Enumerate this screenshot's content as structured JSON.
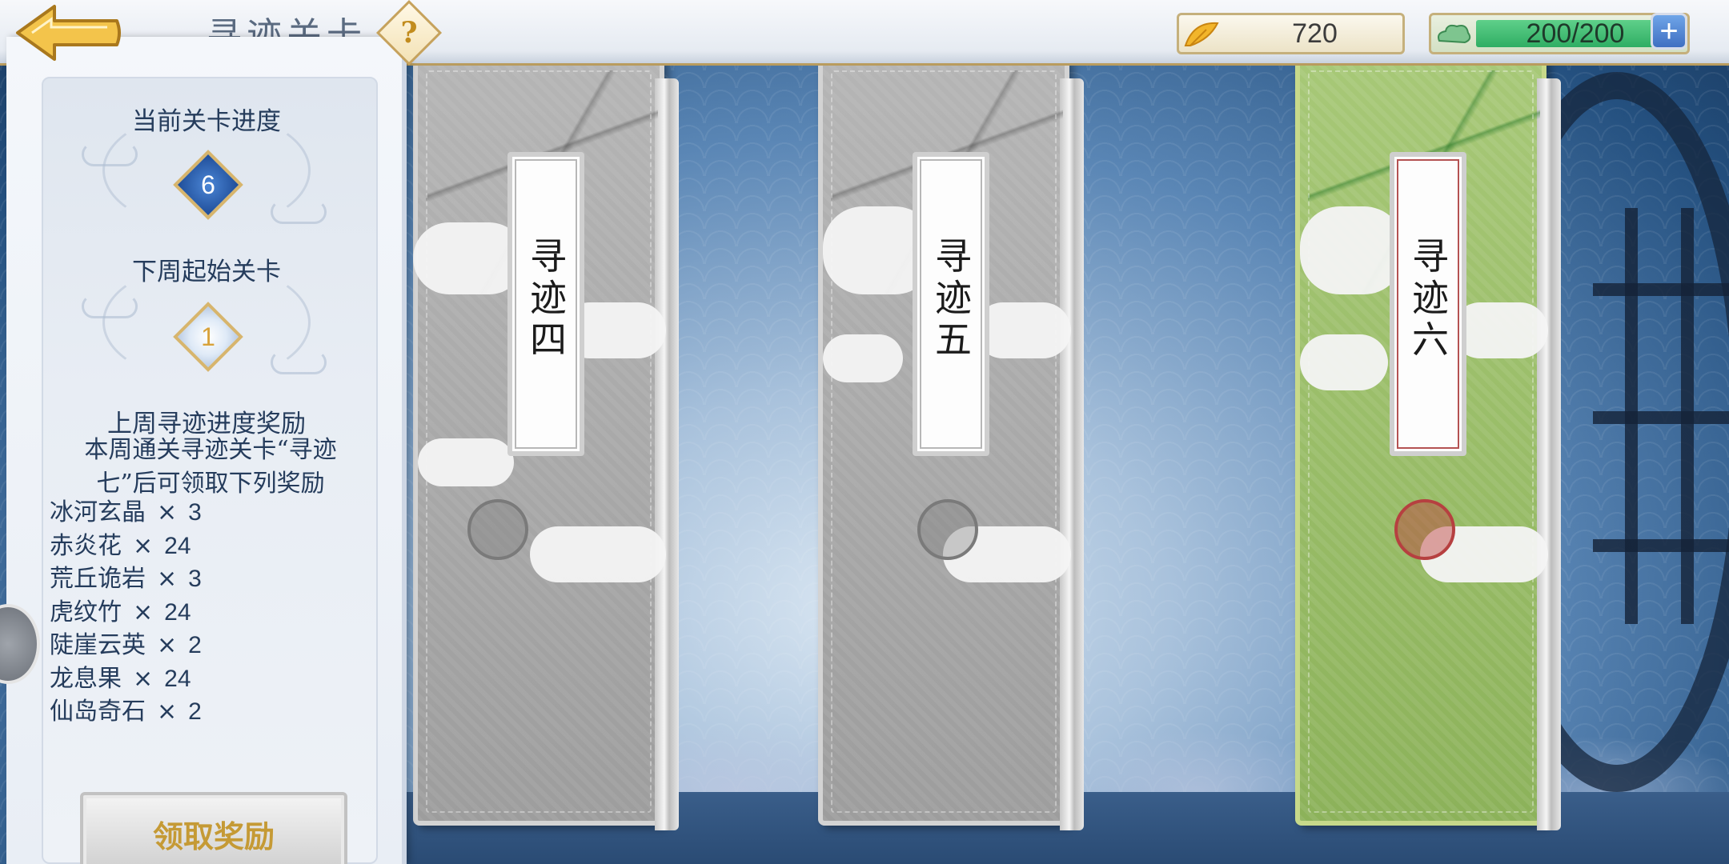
{
  "header": {
    "title": "寻迹关卡",
    "help_symbol": "?",
    "coins": "720",
    "stamina": "200/200",
    "stamina_fill": 1.0,
    "plus_symbol": "+",
    "icons": {
      "back": "back-arrow-icon",
      "help": "help-icon",
      "coins": "ginkgo-leaf-icon",
      "stamina": "cloud-icon",
      "plus": "plus-icon"
    }
  },
  "panel": {
    "current_progress_label": "当前关卡进度",
    "current_progress_value": "6",
    "next_week_label": "下周起始关卡",
    "next_week_value": "1",
    "reward_title": "上周寻迹进度奖励",
    "reward_desc_line1": "本周通关寻迹关卡“寻迹",
    "reward_desc_line2": "七”后可领取下列奖励",
    "rewards": [
      {
        "name": "冰河玄晶",
        "qty": "3"
      },
      {
        "name": "赤炎花",
        "qty": "24"
      },
      {
        "name": "荒丘诡岩",
        "qty": "3"
      },
      {
        "name": "虎纹竹",
        "qty": "24"
      },
      {
        "name": "陡崖云英",
        "qty": "2"
      },
      {
        "name": "龙息果",
        "qty": "24"
      },
      {
        "name": "仙岛奇石",
        "qty": "2"
      }
    ],
    "times_symbol": "×",
    "claim_button": "领取奖励"
  },
  "stages": [
    {
      "label": "寻迹四",
      "state": "locked"
    },
    {
      "label": "寻迹五",
      "state": "locked"
    },
    {
      "label": "寻迹六",
      "state": "active"
    }
  ],
  "colors": {
    "panel_text": "#253c5c",
    "locked_card": "#a8a8a8",
    "active_card": "#97b967",
    "claim_text": "#c59a35"
  }
}
